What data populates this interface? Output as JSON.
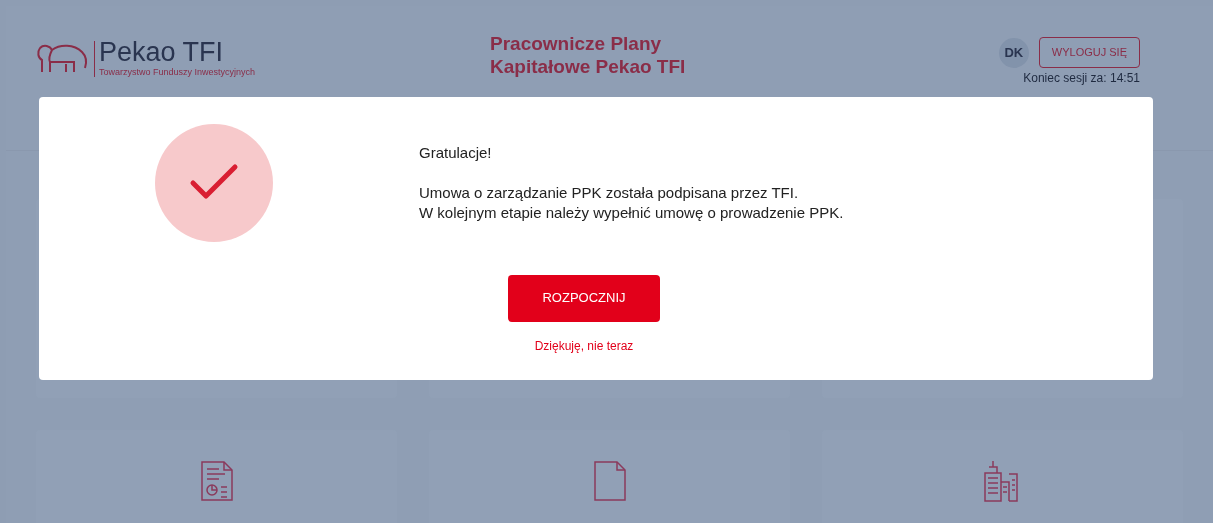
{
  "header": {
    "logo": {
      "name": "Pekao TFI",
      "tagline": "Towarzystwo Funduszy Inwestycyjnych"
    },
    "title": [
      "Pracownicze Plany",
      "Kapitałowe Pekao TFI"
    ],
    "user_initials": "DK",
    "logout_button": "WYLOGUJ SIĘ",
    "session": "Koniec sesji za: 14:51"
  },
  "dialog": {
    "heading": "Gratulacje!",
    "message": [
      "Umowa o zarządzanie PPK została podpisana przez TFI.",
      "W kolejnym etapie należy wypełnić umowę o prowadzenie PPK."
    ],
    "primary_button": "ROZPOCZNIJ",
    "secondary_link": "Dziękuję, nie teraz"
  }
}
